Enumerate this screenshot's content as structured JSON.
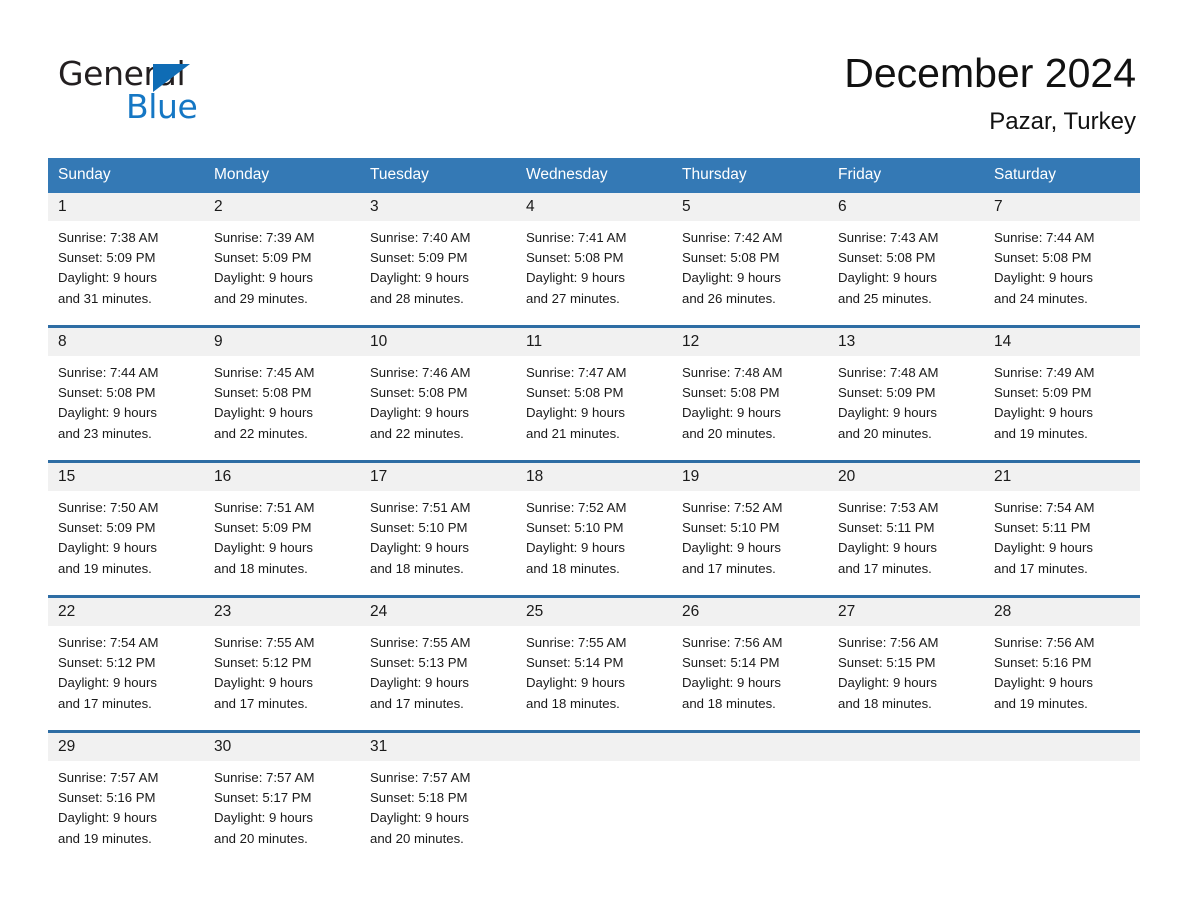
{
  "brand": {
    "name_top": "General",
    "name_bottom": "Blue",
    "triangle_icon": "triangle-icon",
    "top_color": "#231f20",
    "bottom_color": "#1577c4",
    "accent_color": "#0f6cb5"
  },
  "header": {
    "month_title": "December 2024",
    "location": "Pazar, Turkey"
  },
  "theme": {
    "header_row_bg": "#3479b5",
    "row_divider": "#2e6da4",
    "day_band_bg": "#f1f1f1",
    "page_bg": "#ffffff",
    "text": "#1a1a1a"
  },
  "calendar": {
    "weekday_headers": [
      "Sunday",
      "Monday",
      "Tuesday",
      "Wednesday",
      "Thursday",
      "Friday",
      "Saturday"
    ],
    "weeks": [
      [
        {
          "day": "1",
          "sunrise": "Sunrise: 7:38 AM",
          "sunset": "Sunset: 5:09 PM",
          "daylight_line1": "Daylight: 9 hours",
          "daylight_line2": "and 31 minutes."
        },
        {
          "day": "2",
          "sunrise": "Sunrise: 7:39 AM",
          "sunset": "Sunset: 5:09 PM",
          "daylight_line1": "Daylight: 9 hours",
          "daylight_line2": "and 29 minutes."
        },
        {
          "day": "3",
          "sunrise": "Sunrise: 7:40 AM",
          "sunset": "Sunset: 5:09 PM",
          "daylight_line1": "Daylight: 9 hours",
          "daylight_line2": "and 28 minutes."
        },
        {
          "day": "4",
          "sunrise": "Sunrise: 7:41 AM",
          "sunset": "Sunset: 5:08 PM",
          "daylight_line1": "Daylight: 9 hours",
          "daylight_line2": "and 27 minutes."
        },
        {
          "day": "5",
          "sunrise": "Sunrise: 7:42 AM",
          "sunset": "Sunset: 5:08 PM",
          "daylight_line1": "Daylight: 9 hours",
          "daylight_line2": "and 26 minutes."
        },
        {
          "day": "6",
          "sunrise": "Sunrise: 7:43 AM",
          "sunset": "Sunset: 5:08 PM",
          "daylight_line1": "Daylight: 9 hours",
          "daylight_line2": "and 25 minutes."
        },
        {
          "day": "7",
          "sunrise": "Sunrise: 7:44 AM",
          "sunset": "Sunset: 5:08 PM",
          "daylight_line1": "Daylight: 9 hours",
          "daylight_line2": "and 24 minutes."
        }
      ],
      [
        {
          "day": "8",
          "sunrise": "Sunrise: 7:44 AM",
          "sunset": "Sunset: 5:08 PM",
          "daylight_line1": "Daylight: 9 hours",
          "daylight_line2": "and 23 minutes."
        },
        {
          "day": "9",
          "sunrise": "Sunrise: 7:45 AM",
          "sunset": "Sunset: 5:08 PM",
          "daylight_line1": "Daylight: 9 hours",
          "daylight_line2": "and 22 minutes."
        },
        {
          "day": "10",
          "sunrise": "Sunrise: 7:46 AM",
          "sunset": "Sunset: 5:08 PM",
          "daylight_line1": "Daylight: 9 hours",
          "daylight_line2": "and 22 minutes."
        },
        {
          "day": "11",
          "sunrise": "Sunrise: 7:47 AM",
          "sunset": "Sunset: 5:08 PM",
          "daylight_line1": "Daylight: 9 hours",
          "daylight_line2": "and 21 minutes."
        },
        {
          "day": "12",
          "sunrise": "Sunrise: 7:48 AM",
          "sunset": "Sunset: 5:08 PM",
          "daylight_line1": "Daylight: 9 hours",
          "daylight_line2": "and 20 minutes."
        },
        {
          "day": "13",
          "sunrise": "Sunrise: 7:48 AM",
          "sunset": "Sunset: 5:09 PM",
          "daylight_line1": "Daylight: 9 hours",
          "daylight_line2": "and 20 minutes."
        },
        {
          "day": "14",
          "sunrise": "Sunrise: 7:49 AM",
          "sunset": "Sunset: 5:09 PM",
          "daylight_line1": "Daylight: 9 hours",
          "daylight_line2": "and 19 minutes."
        }
      ],
      [
        {
          "day": "15",
          "sunrise": "Sunrise: 7:50 AM",
          "sunset": "Sunset: 5:09 PM",
          "daylight_line1": "Daylight: 9 hours",
          "daylight_line2": "and 19 minutes."
        },
        {
          "day": "16",
          "sunrise": "Sunrise: 7:51 AM",
          "sunset": "Sunset: 5:09 PM",
          "daylight_line1": "Daylight: 9 hours",
          "daylight_line2": "and 18 minutes."
        },
        {
          "day": "17",
          "sunrise": "Sunrise: 7:51 AM",
          "sunset": "Sunset: 5:10 PM",
          "daylight_line1": "Daylight: 9 hours",
          "daylight_line2": "and 18 minutes."
        },
        {
          "day": "18",
          "sunrise": "Sunrise: 7:52 AM",
          "sunset": "Sunset: 5:10 PM",
          "daylight_line1": "Daylight: 9 hours",
          "daylight_line2": "and 18 minutes."
        },
        {
          "day": "19",
          "sunrise": "Sunrise: 7:52 AM",
          "sunset": "Sunset: 5:10 PM",
          "daylight_line1": "Daylight: 9 hours",
          "daylight_line2": "and 17 minutes."
        },
        {
          "day": "20",
          "sunrise": "Sunrise: 7:53 AM",
          "sunset": "Sunset: 5:11 PM",
          "daylight_line1": "Daylight: 9 hours",
          "daylight_line2": "and 17 minutes."
        },
        {
          "day": "21",
          "sunrise": "Sunrise: 7:54 AM",
          "sunset": "Sunset: 5:11 PM",
          "daylight_line1": "Daylight: 9 hours",
          "daylight_line2": "and 17 minutes."
        }
      ],
      [
        {
          "day": "22",
          "sunrise": "Sunrise: 7:54 AM",
          "sunset": "Sunset: 5:12 PM",
          "daylight_line1": "Daylight: 9 hours",
          "daylight_line2": "and 17 minutes."
        },
        {
          "day": "23",
          "sunrise": "Sunrise: 7:55 AM",
          "sunset": "Sunset: 5:12 PM",
          "daylight_line1": "Daylight: 9 hours",
          "daylight_line2": "and 17 minutes."
        },
        {
          "day": "24",
          "sunrise": "Sunrise: 7:55 AM",
          "sunset": "Sunset: 5:13 PM",
          "daylight_line1": "Daylight: 9 hours",
          "daylight_line2": "and 17 minutes."
        },
        {
          "day": "25",
          "sunrise": "Sunrise: 7:55 AM",
          "sunset": "Sunset: 5:14 PM",
          "daylight_line1": "Daylight: 9 hours",
          "daylight_line2": "and 18 minutes."
        },
        {
          "day": "26",
          "sunrise": "Sunrise: 7:56 AM",
          "sunset": "Sunset: 5:14 PM",
          "daylight_line1": "Daylight: 9 hours",
          "daylight_line2": "and 18 minutes."
        },
        {
          "day": "27",
          "sunrise": "Sunrise: 7:56 AM",
          "sunset": "Sunset: 5:15 PM",
          "daylight_line1": "Daylight: 9 hours",
          "daylight_line2": "and 18 minutes."
        },
        {
          "day": "28",
          "sunrise": "Sunrise: 7:56 AM",
          "sunset": "Sunset: 5:16 PM",
          "daylight_line1": "Daylight: 9 hours",
          "daylight_line2": "and 19 minutes."
        }
      ],
      [
        {
          "day": "29",
          "sunrise": "Sunrise: 7:57 AM",
          "sunset": "Sunset: 5:16 PM",
          "daylight_line1": "Daylight: 9 hours",
          "daylight_line2": "and 19 minutes."
        },
        {
          "day": "30",
          "sunrise": "Sunrise: 7:57 AM",
          "sunset": "Sunset: 5:17 PM",
          "daylight_line1": "Daylight: 9 hours",
          "daylight_line2": "and 20 minutes."
        },
        {
          "day": "31",
          "sunrise": "Sunrise: 7:57 AM",
          "sunset": "Sunset: 5:18 PM",
          "daylight_line1": "Daylight: 9 hours",
          "daylight_line2": "and 20 minutes."
        },
        {
          "day": "",
          "sunrise": "",
          "sunset": "",
          "daylight_line1": "",
          "daylight_line2": ""
        },
        {
          "day": "",
          "sunrise": "",
          "sunset": "",
          "daylight_line1": "",
          "daylight_line2": ""
        },
        {
          "day": "",
          "sunrise": "",
          "sunset": "",
          "daylight_line1": "",
          "daylight_line2": ""
        },
        {
          "day": "",
          "sunrise": "",
          "sunset": "",
          "daylight_line1": "",
          "daylight_line2": ""
        }
      ]
    ]
  }
}
